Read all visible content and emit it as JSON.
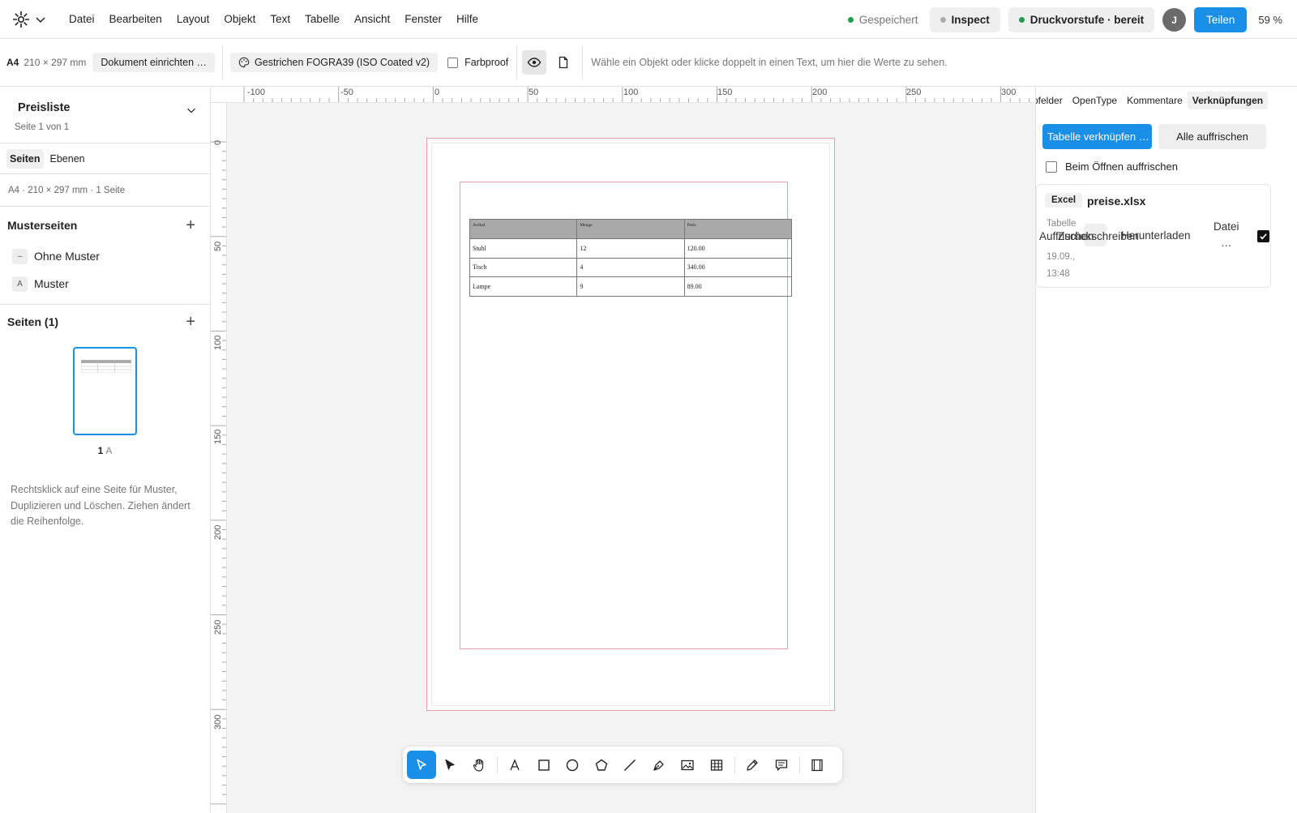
{
  "menu": {
    "items": [
      "Datei",
      "Bearbeiten",
      "Layout",
      "Objekt",
      "Text",
      "Tabelle",
      "Ansicht",
      "Fenster",
      "Hilfe"
    ]
  },
  "status": {
    "saved": "Gespeichert",
    "saved_color": "#1e9e4a",
    "inspect": "Inspect",
    "prepress": "Druckvorstufe · bereit",
    "prepress_color": "#1e9e4a",
    "avatar": "J",
    "share": "Teilen",
    "zoom": "59 %"
  },
  "toolbar": {
    "format": "A4",
    "dimensions": "210 × 297 mm",
    "setup": "Dokument einrichten …",
    "profile": "Gestrichen FOGRA39 (ISO Coated v2)",
    "farbproof": "Farbproof",
    "hint": "Wähle ein Objekt oder klicke doppelt in einen Text, um hier die Werte zu sehen."
  },
  "left": {
    "doc_title": "Preisliste",
    "doc_sub": "Seite 1 von 1",
    "tabs": [
      "Seiten",
      "Ebenen"
    ],
    "doc_info": "A4 · 210 × 297 mm · 1 Seite",
    "masters_head": "Musterseiten",
    "masters": [
      {
        "badge": "–",
        "label": "Ohne Muster"
      },
      {
        "badge": "A",
        "label": "Muster"
      }
    ],
    "pages_head": "Seiten (1)",
    "page_number": "1",
    "page_master": "A",
    "hint": "Rechtsklick auf eine Seite für Muster, Duplizieren und Löschen. Ziehen ändert die Reihenfolge."
  },
  "rulers": {
    "top": [
      "-100",
      "-50",
      "0",
      "50",
      "100",
      "150",
      "200",
      "250",
      "300"
    ],
    "left": [
      "0",
      "50",
      "100",
      "150",
      "200",
      "250",
      "300"
    ]
  },
  "table": {
    "headers": [
      "Artikel",
      "Menge",
      "Preis"
    ],
    "rows": [
      [
        "Stuhl",
        "12",
        "120.00"
      ],
      [
        "Tisch",
        "4",
        "340.00"
      ],
      [
        "Lampe",
        "9",
        "89.00"
      ]
    ]
  },
  "right": {
    "tabs": [
      "Farbfelder",
      "OpenType",
      "Kommentare",
      "Verknüpfungen"
    ],
    "link_table": "Tabelle verknüpfen …",
    "refresh_all": "Alle auffrischen",
    "refresh_on_open": "Beim Öffnen auffrischen",
    "card": {
      "type": "Excel",
      "file": "preise.xlsx",
      "meta_lines": [
        "Tabelle",
        "",
        "19.09.,",
        "13:48"
      ],
      "refresh": "Auffrischen",
      "writeback": "Zurückschreiben",
      "download": "Herunterladen",
      "file_label": "Datei",
      "more": "…"
    }
  },
  "colors": {
    "accent": "#1a8fe8",
    "bleed": "#e3a2ab",
    "table_header": "#a9a9a9"
  }
}
